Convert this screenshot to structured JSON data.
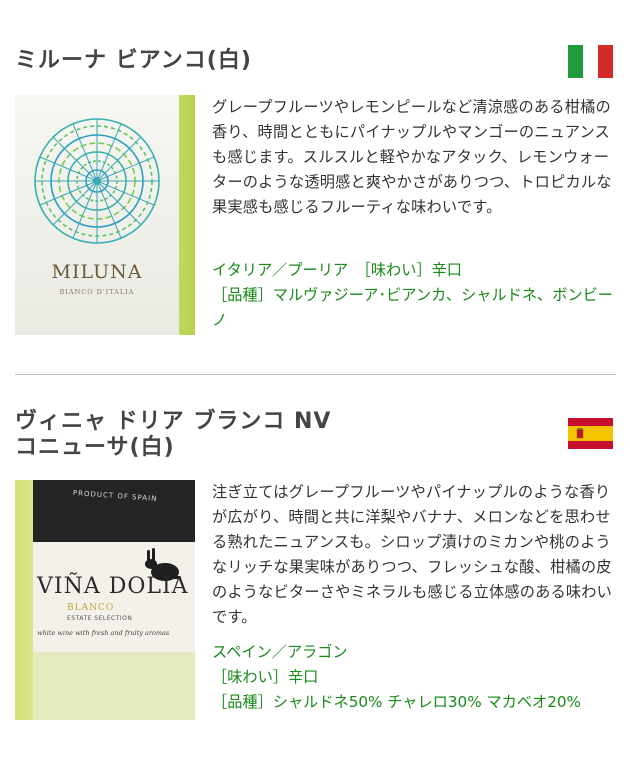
{
  "wines": [
    {
      "title": "ミルーナ ビアンコ(白)",
      "flag": "italy-flag-icon",
      "label_brand": "MILUNA",
      "label_sub": "BIANCO D'ITALIA",
      "description": "グレープフルーツやレモンピールなど清涼感のある柑橘の香り、時間とともにパイナップルやマンゴーのニュアンスも感じます。スルスルと軽やかなアタック、レモンウォーターのような透明感と爽やかさがありつつ、トロピカルな果実感も感じるフルーティな味わいです。",
      "origin_taste": "イタリア／プーリア　［味わい］辛口",
      "grapes": "［品種］マルヴァジーア･ビアンカ、シャルドネ、ボンビーノ"
    },
    {
      "title_line1": "ヴィニャ ドリア ブランコ NV",
      "title_line2": "コニューサ(白)",
      "flag": "spain-flag-icon",
      "label_top": "PRODUCT OF SPAIN",
      "label_brand": "VIÑA DOLIA",
      "label_blanco": "BLANCO",
      "label_estate": "ESTATE SELECTION",
      "label_script": "white wine with fresh and fruity aromas",
      "description": "注ぎ立てはグレープフルーツやパイナップルのような香りが広がり、時間と共に洋梨やバナナ、メロンなどを思わせる熟れたニュアンスも。シロップ漬けのミカンや桃のようなリッチな果実味がありつつ、フレッシュな酸、柑橘の皮のようなビターさやミネラルも感じる立体感のある味わいです。",
      "origin": "スペイン／アラゴン",
      "taste": "［味わい］辛口",
      "grapes": "［品種］シャルドネ50%  チャレロ30%  マカベオ20%"
    }
  ],
  "colors": {
    "meta_green": "#1a8a1a",
    "italy_green": "#1f9a3c",
    "italy_red": "#d42a2a",
    "spain_red": "#c8102e",
    "spain_yellow": "#f5c400"
  }
}
